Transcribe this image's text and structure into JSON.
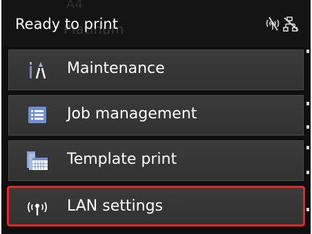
{
  "status": {
    "text": "Ready to print",
    "ghost_line_1": "A4",
    "ghost_line_2": "Platinum",
    "icons": [
      "wireless-off-icon",
      "wired-lan-off-icon"
    ]
  },
  "menu": {
    "items": [
      {
        "label": "Maintenance",
        "icon": "maintenance-tools-icon"
      },
      {
        "label": "Job management",
        "icon": "job-list-icon"
      },
      {
        "label": "Template print",
        "icon": "template-print-icon"
      },
      {
        "label": "LAN settings",
        "icon": "lan-antenna-icon",
        "selected": true
      }
    ]
  },
  "colors": {
    "selection_border": "#e0282f",
    "item_background": "#363636",
    "icon_blue": "#6f8fd0"
  }
}
